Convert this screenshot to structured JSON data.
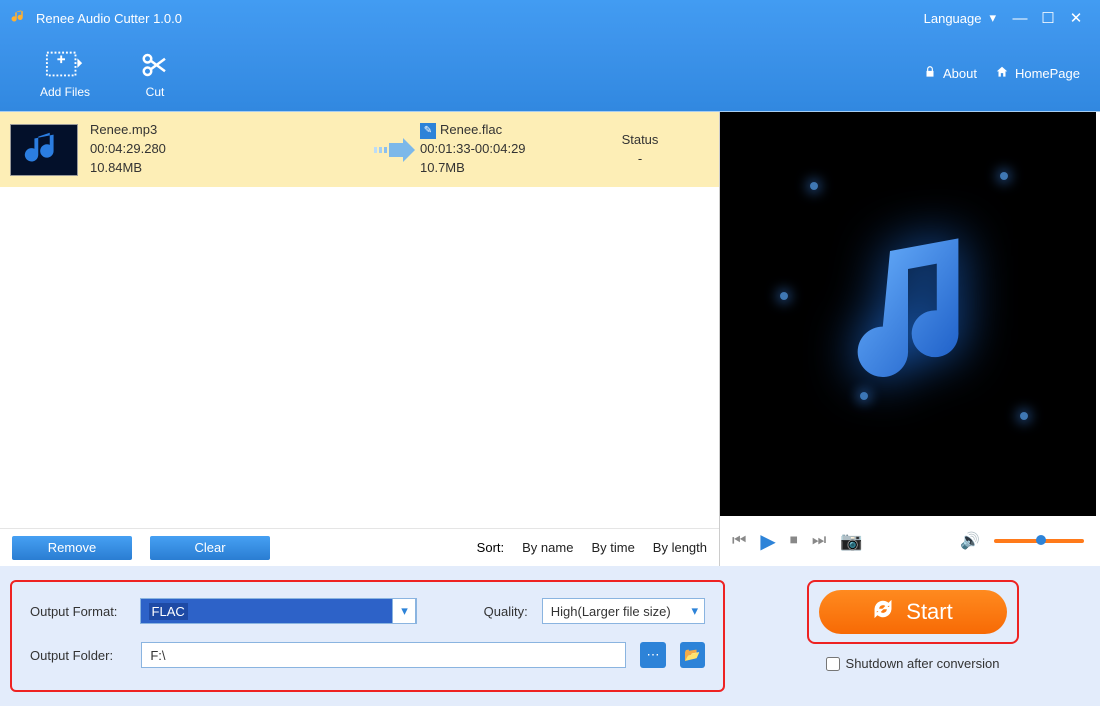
{
  "titlebar": {
    "title": "Renee Audio Cutter 1.0.0",
    "language": "Language"
  },
  "toolbar": {
    "addFiles": "Add Files",
    "cut": "Cut",
    "about": "About",
    "homepage": "HomePage"
  },
  "file": {
    "src": {
      "name": "Renee.mp3",
      "duration": "00:04:29.280",
      "size": "10.84MB"
    },
    "dst": {
      "name": "Renee.flac",
      "range": "00:01:33-00:04:29",
      "size": "10.7MB"
    },
    "statusLabel": "Status",
    "statusValue": "-"
  },
  "actions": {
    "remove": "Remove",
    "clear": "Clear"
  },
  "sort": {
    "label": "Sort:",
    "byName": "By name",
    "byTime": "By time",
    "byLength": "By length"
  },
  "output": {
    "formatLabel": "Output Format:",
    "formatValue": "FLAC",
    "qualityLabel": "Quality:",
    "qualityValue": "High(Larger file size)",
    "folderLabel": "Output Folder:",
    "folderValue": "F:\\"
  },
  "start": {
    "label": "Start",
    "shutdown": "Shutdown after conversion"
  }
}
